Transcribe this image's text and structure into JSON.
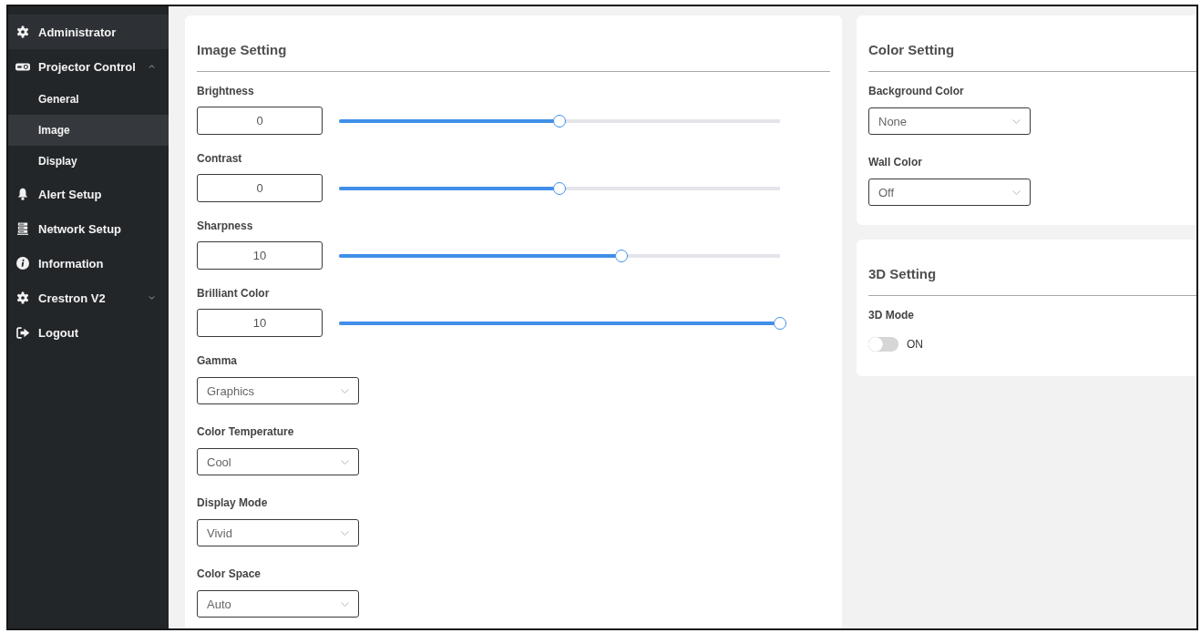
{
  "sidebar": {
    "items": [
      {
        "label": "Administrator",
        "highlighted": true
      },
      {
        "label": "Projector Control",
        "highlighted": false,
        "expanded": true,
        "children": [
          {
            "label": "General",
            "selected": false
          },
          {
            "label": "Image",
            "selected": true
          },
          {
            "label": "Display",
            "selected": false
          }
        ]
      },
      {
        "label": "Alert Setup",
        "highlighted": false
      },
      {
        "label": "Network Setup",
        "highlighted": false
      },
      {
        "label": "Information",
        "highlighted": false
      },
      {
        "label": "Crestron V2",
        "highlighted": false,
        "expanded": false
      },
      {
        "label": "Logout",
        "highlighted": false
      }
    ]
  },
  "image_setting": {
    "title": "Image Setting",
    "sliders": [
      {
        "label": "Brightness",
        "value": "0",
        "level": 0.5
      },
      {
        "label": "Contrast",
        "value": "0",
        "level": 0.5
      },
      {
        "label": "Sharpness",
        "value": "10",
        "level": 0.64
      },
      {
        "label": "Brilliant Color",
        "value": "10",
        "level": 1
      }
    ],
    "dropdowns": [
      {
        "label": "Gamma",
        "value": "Graphics"
      },
      {
        "label": "Color Temperature",
        "value": "Cool"
      },
      {
        "label": "Display Mode",
        "value": "Vivid"
      },
      {
        "label": "Color Space",
        "value": "Auto"
      }
    ]
  },
  "color_setting": {
    "title": "Color Setting",
    "dropdowns": [
      {
        "label": "Background Color",
        "value": "None"
      },
      {
        "label": "Wall Color",
        "value": "Off"
      }
    ]
  },
  "three_d_setting": {
    "title": "3D Setting",
    "toggle": {
      "label": "3D Mode",
      "text": "ON",
      "on": false
    }
  }
}
